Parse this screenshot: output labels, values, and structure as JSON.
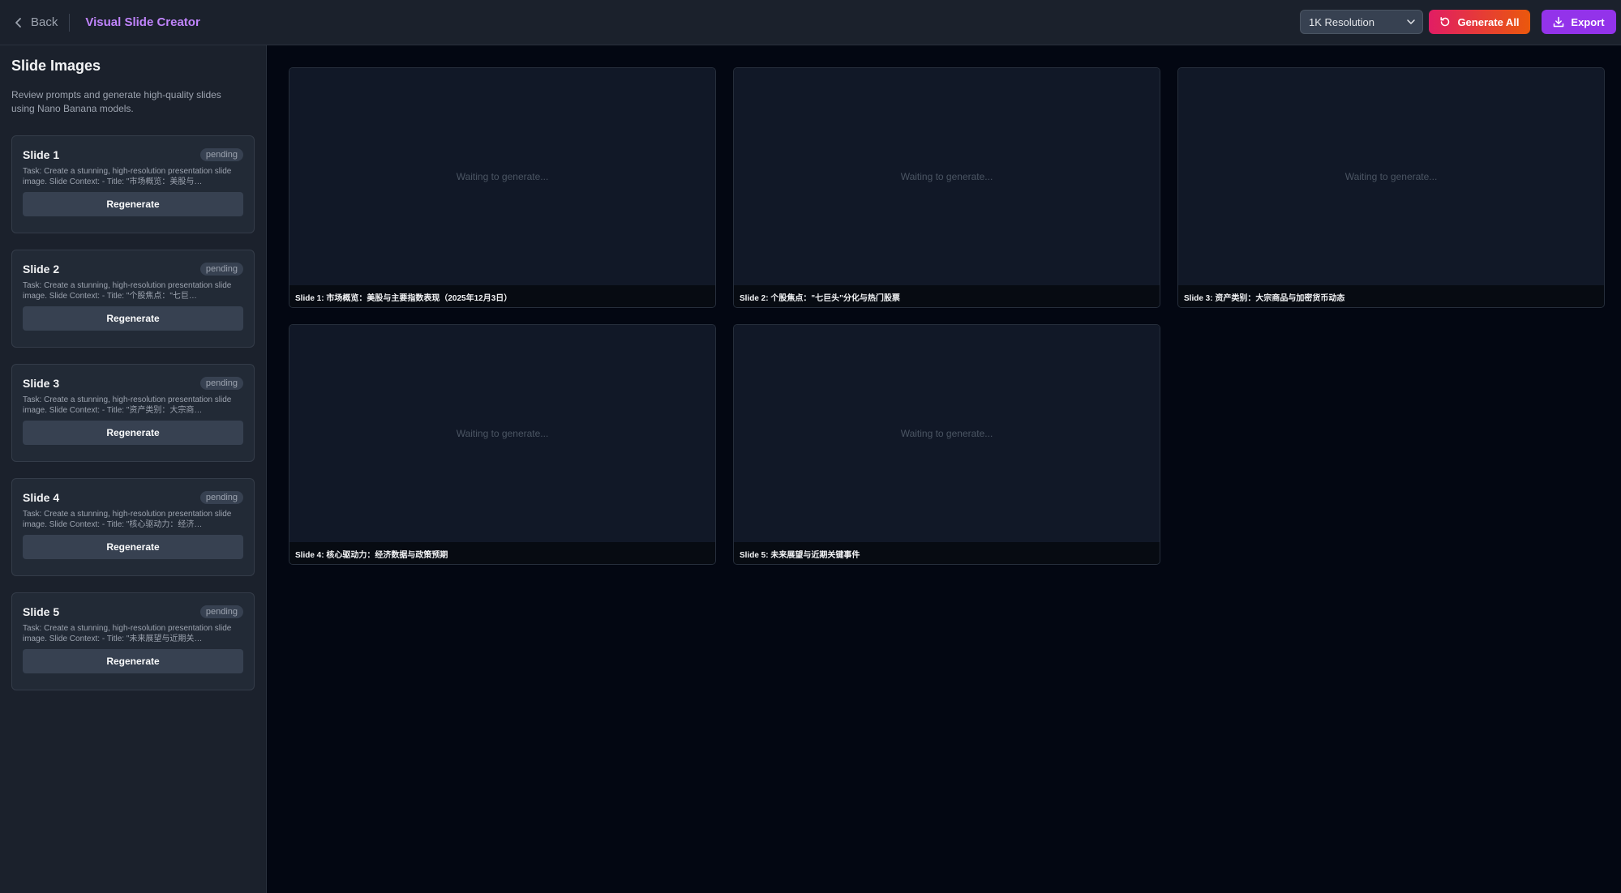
{
  "header": {
    "back_label": "Back",
    "app_title": "Visual Slide Creator",
    "resolution": "1K Resolution",
    "generate_all_label": "Generate All",
    "export_label": "Export"
  },
  "sidebar": {
    "title": "Slide Images",
    "description": "Review prompts and generate high-quality slides using Nano Banana models.",
    "slides": [
      {
        "title": "Slide 1",
        "status": "pending",
        "prompt": "Task: Create a stunning, high-resolution presentation slide image. Slide Context: - Title: \"市场概览：美股与…",
        "regenerate_label": "Regenerate"
      },
      {
        "title": "Slide 2",
        "status": "pending",
        "prompt": "Task: Create a stunning, high-resolution presentation slide image. Slide Context: - Title: \"个股焦点：\"七巨…",
        "regenerate_label": "Regenerate"
      },
      {
        "title": "Slide 3",
        "status": "pending",
        "prompt": "Task: Create a stunning, high-resolution presentation slide image. Slide Context: - Title: \"资产类别：大宗商…",
        "regenerate_label": "Regenerate"
      },
      {
        "title": "Slide 4",
        "status": "pending",
        "prompt": "Task: Create a stunning, high-resolution presentation slide image. Slide Context: - Title: \"核心驱动力：经济…",
        "regenerate_label": "Regenerate"
      },
      {
        "title": "Slide 5",
        "status": "pending",
        "prompt": "Task: Create a stunning, high-resolution presentation slide image. Slide Context: - Title: \"未来展望与近期关…",
        "regenerate_label": "Regenerate"
      }
    ]
  },
  "previews": [
    {
      "placeholder": "Waiting to generate...",
      "caption": "Slide 1: 市场概览：美股与主要指数表现（2025年12月3日）"
    },
    {
      "placeholder": "Waiting to generate...",
      "caption": "Slide 2: 个股焦点：\"七巨头\"分化与热门股票"
    },
    {
      "placeholder": "Waiting to generate...",
      "caption": "Slide 3: 资产类别：大宗商品与加密货币动态"
    },
    {
      "placeholder": "Waiting to generate...",
      "caption": "Slide 4: 核心驱动力：经济数据与政策预期"
    },
    {
      "placeholder": "Waiting to generate...",
      "caption": "Slide 5: 未来展望与近期关键事件"
    }
  ],
  "icons": {
    "back": "chevron-left-icon",
    "select": "chevron-down-icon",
    "generate": "refresh-icon",
    "export": "download-icon"
  },
  "colors": {
    "accent_title": "#c084fc",
    "generate_gradient_start": "#e11d64",
    "generate_gradient_end": "#ea580c",
    "export": "#9333ea"
  }
}
